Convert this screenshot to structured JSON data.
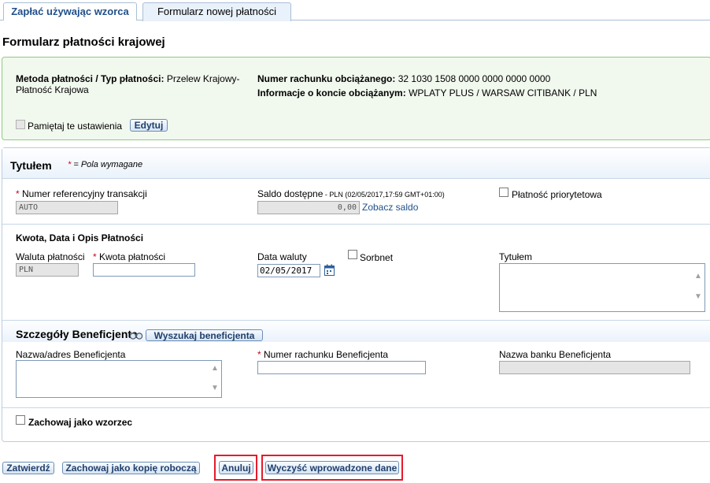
{
  "tabs": {
    "template_tab": "Zapłać używając wzorca",
    "new_payment_tab": "Formularz nowej płatności"
  },
  "page_title": "Formularz płatności krajowej",
  "method_box": {
    "method_label": "Metoda płatności / Typ płatności:",
    "method_value_line1": "Przelew Krajowy-",
    "method_value_line2": "Płatność Krajowa",
    "account_label": "Numer rachunku obciążanego:",
    "account_value": "32 1030 1508 0000 0000 0000 0000",
    "info_label": "Informacje o koncie obciążanym:",
    "info_value": "WPLATY PLUS / WARSAW CITIBANK / PLN",
    "remember_label": "Pamiętaj te ustawienia",
    "edit_button": "Edytuj"
  },
  "title_section": {
    "heading": "Tytułem",
    "required_note_star": "*",
    "required_note": "= Pola wymagane",
    "ref_label": "Numer referencyjny transakcji",
    "ref_value": "AUTO",
    "balance_label": "Saldo dostępne",
    "balance_sub": " - PLN (02/05/2017,17:59 GMT+01:00)",
    "balance_value": "0,00",
    "balance_link": "Zobacz saldo",
    "priority_label": "Płatność priorytetowa"
  },
  "amount_section": {
    "heading": "Kwota, Data i Opis Płatności",
    "currency_label": "Waluta płatności",
    "currency_value": "PLN",
    "amount_label": "Kwota płatności",
    "amount_value": "",
    "date_label": "Data waluty",
    "date_value": "02/05/2017",
    "sorbnet_label": "Sorbnet",
    "title_label": "Tytułem"
  },
  "beneficiary_section": {
    "heading": "Szczegóły Beneficjenta",
    "search_button": "Wyszukaj beneficjenta",
    "name_label": "Nazwa/adres Beneficjenta",
    "account_label": "Numer rachunku Beneficjenta",
    "bank_label": "Nazwa banku Beneficjenta",
    "save_template_label": "Zachowaj jako wzorzec"
  },
  "actions": {
    "confirm": "Zatwierdź",
    "save_draft": "Zachowaj jako kopię roboczą",
    "cancel": "Anuluj",
    "clear": "Wyczyść wprowadzone dane"
  },
  "colors": {
    "link": "#1f4f8b",
    "required": "#d0021b",
    "highlight": "#e8192c",
    "method_box_bg": "#f1f8ee"
  }
}
